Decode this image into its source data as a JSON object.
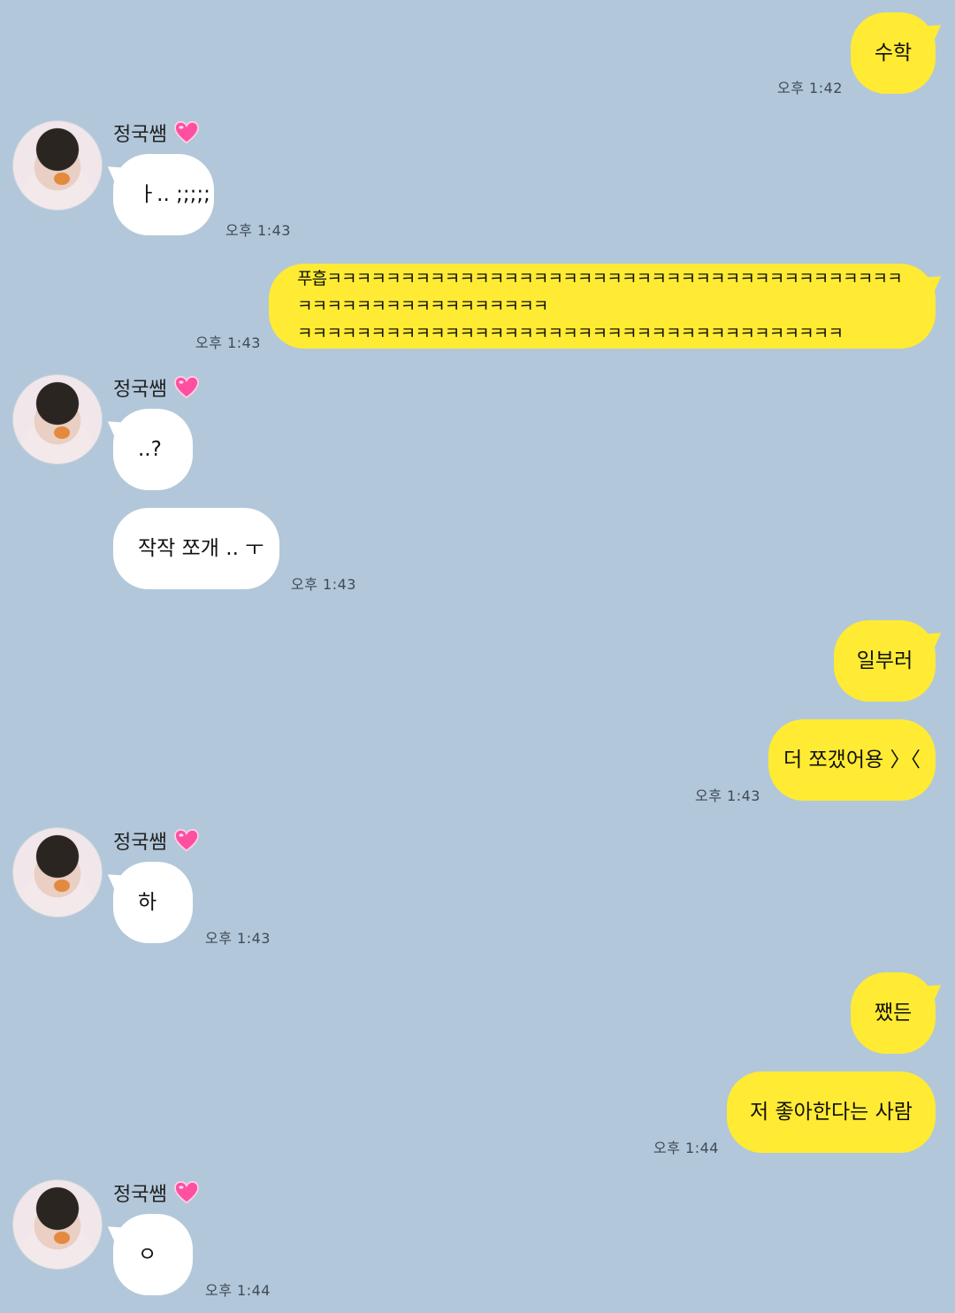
{
  "colors": {
    "background": "#b2c7da",
    "my_bubble": "#ffeb33",
    "their_bubble": "#ffffff",
    "heart": "#ff4fa0"
  },
  "contact": {
    "name": "정국쌤",
    "badge_icon": "pink-heart-icon"
  },
  "messages": [
    {
      "sender": "me",
      "text": "수학",
      "time": "오후 1:42"
    },
    {
      "sender": "them",
      "text": "ㅏ.. ;;;;;",
      "time": "오후 1:43"
    },
    {
      "sender": "me",
      "line1": "푸흡ㅋㅋㅋㅋㅋㅋㅋㅋㅋㅋㅋㅋㅋㅋㅋㅋㅋㅋㅋㅋㅋㅋㅋㅋㅋㅋㅋㅋㅋㅋㅋㅋㅋㅋㅋㅋㅋㅋㅋㅋㅋㅋㅋㅋㅋㅋㅋㅋㅋㅋㅋㅋㅋㅋㅋㅋ",
      "line2": "ㅋㅋㅋㅋㅋㅋㅋㅋㅋㅋㅋㅋㅋㅋㅋㅋㅋㅋㅋㅋㅋㅋㅋㅋㅋㅋㅋㅋㅋㅋㅋㅋㅋㅋㅋㅋㅋ",
      "time": "오후 1:43"
    },
    {
      "sender": "them",
      "text": "..?",
      "time": ""
    },
    {
      "sender": "them",
      "text": "작작 쪼개 .. ㅜ",
      "time": "오후 1:43"
    },
    {
      "sender": "me",
      "text": "일부러",
      "time": ""
    },
    {
      "sender": "me",
      "text": "더 쪼갰어용 〉〈",
      "time": "오후 1:43"
    },
    {
      "sender": "them",
      "text": "하",
      "time": "오후 1:43"
    },
    {
      "sender": "me",
      "text": "쨌든",
      "time": ""
    },
    {
      "sender": "me",
      "text": "저 좋아한다는 사람",
      "time": "오후 1:44"
    },
    {
      "sender": "them",
      "text": "ㅇ",
      "time": "오후 1:44"
    }
  ]
}
